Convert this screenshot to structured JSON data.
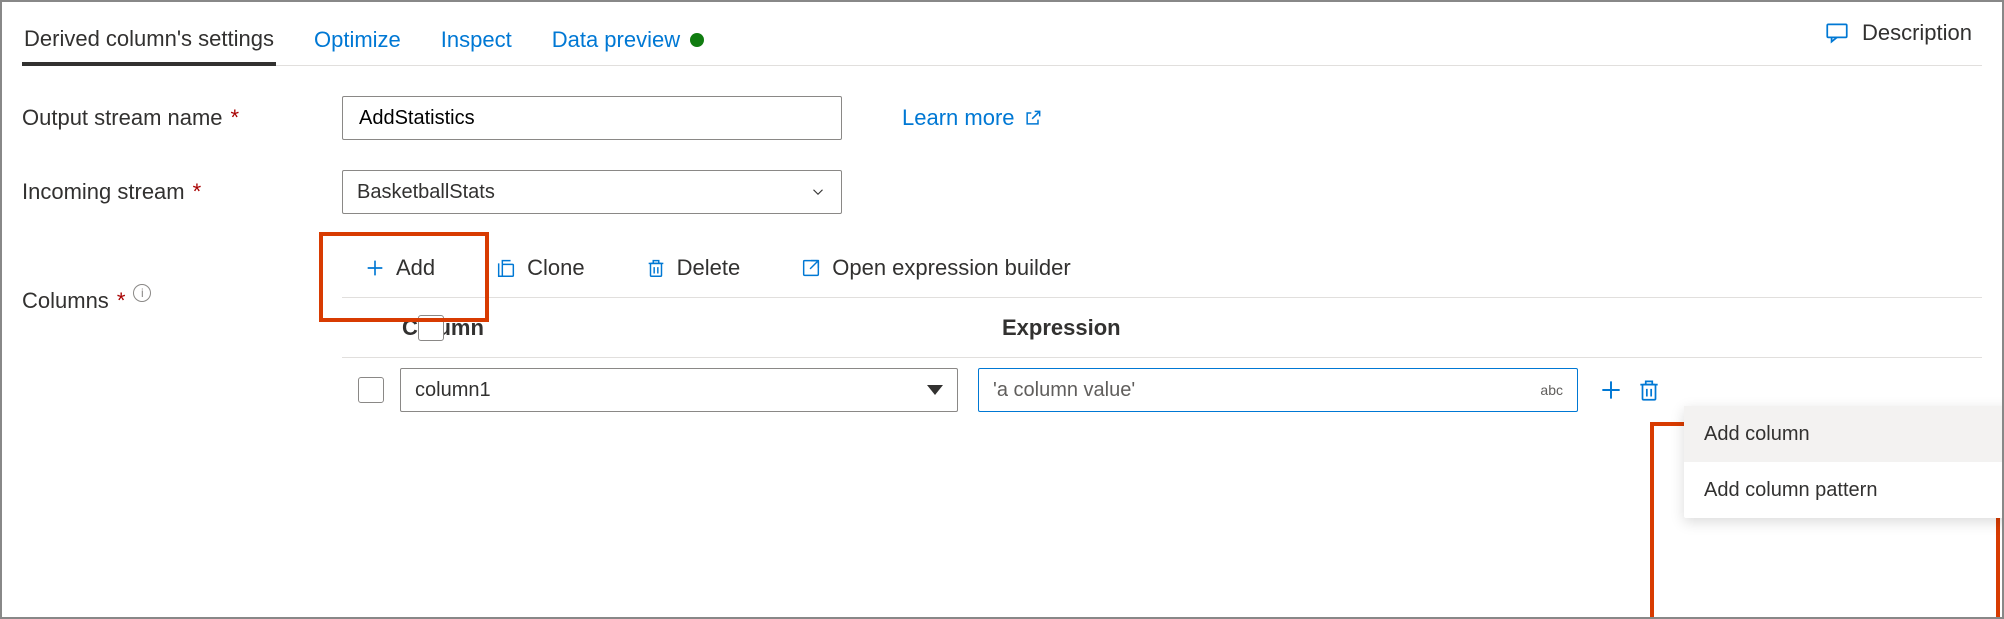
{
  "tabs": {
    "settings": "Derived column's settings",
    "optimize": "Optimize",
    "inspect": "Inspect",
    "preview": "Data preview"
  },
  "header": {
    "description": "Description"
  },
  "form": {
    "output_label": "Output stream name",
    "output_value": "AddStatistics",
    "learn_more": "Learn more",
    "incoming_label": "Incoming stream",
    "incoming_value": "BasketballStats",
    "columns_label": "Columns"
  },
  "toolbar": {
    "add": "Add",
    "clone": "Clone",
    "delete": "Delete",
    "open_builder": "Open expression builder"
  },
  "table": {
    "header_column": "Column",
    "header_expression": "Expression",
    "rows": [
      {
        "column": "column1",
        "expression": "'a column value'",
        "type_badge": "abc"
      }
    ]
  },
  "menu": {
    "add_column": "Add column",
    "add_pattern": "Add column pattern"
  }
}
